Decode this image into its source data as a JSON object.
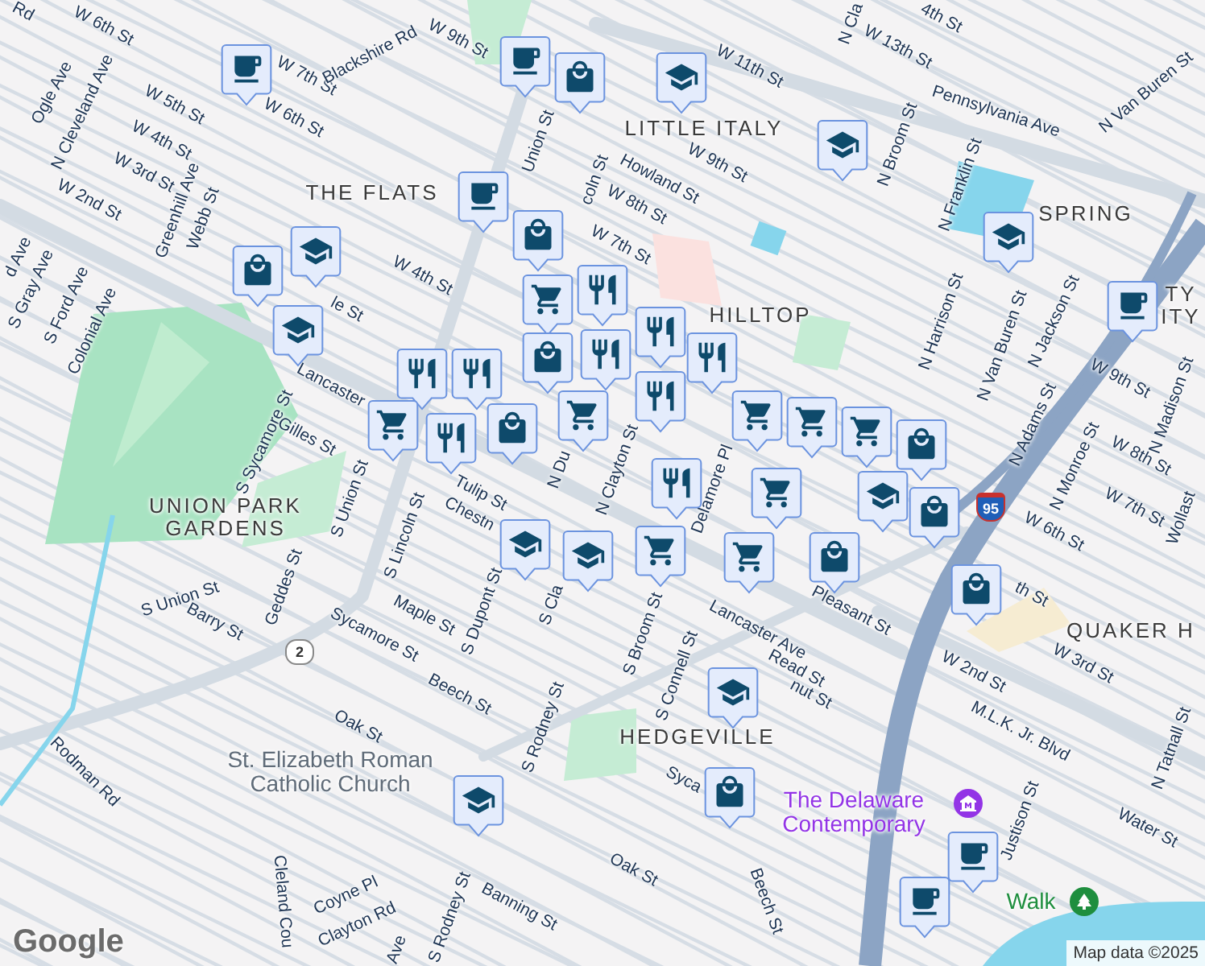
{
  "neighborhoods": [
    "THE FLATS",
    "LITTLE ITALY",
    "HILLTOP",
    "SPRING",
    "TY",
    "ITY",
    "UNION PARK GARDENS",
    "QUAKER H",
    "HEDGEVILLE"
  ],
  "streets": [
    "Rd",
    "W 6th St",
    "W 7th St",
    "Blackshire Rd",
    "W 6th St",
    "W 9th St",
    "W 5th St",
    "Ogle Ave",
    "N Cleveland Ave",
    "W 4th St",
    "W 3rd St",
    "W 2nd St",
    "Greenhill Ave",
    "Webb St",
    "d Ave",
    "S Gray Ave",
    "S Ford Ave",
    "Colonial Ave",
    "W 4th St",
    "le St",
    "Lancaster",
    "S Sycamore St",
    "Gilles St",
    "Union St",
    "coln St",
    "W 11th St",
    "N Cla",
    "W 13th St",
    "4th St",
    "Pennsylvania Ave",
    "N Broom St",
    "N Franklin St",
    "Howland St",
    "W 9th St",
    "W 8th St",
    "W 7th St",
    "N Van Buren St",
    "N Harrison St",
    "N Van Buren St",
    "N Jackson St",
    "W 9th St",
    "N Madison St",
    "N Adams St",
    "N Monroe St",
    "W 8th St",
    "W 7th St",
    "W 6th St",
    "Wollast",
    "N Clayton St",
    "Delamore Pl",
    "N Du",
    "Tulip St",
    "Chestn",
    "S Union St",
    "S Lincoln St",
    "Maple St",
    "S Dupont St",
    "S Cla",
    "Barry St",
    "Geddes St",
    "Sycamore St",
    "S Union St",
    "Beech St",
    "S Rodney St",
    "Oak St",
    "Rodman Rd",
    "Coyne Pl",
    "Clayton Rd",
    "Cleland Cou",
    "Banning St",
    "S Rodney St",
    "S Broom St",
    "S Connell St",
    "Pleasant St",
    "Lancaster Ave",
    "Read St",
    "nut St",
    "W 2nd St",
    "W 3rd St",
    "M.L.K. Jr. Blvd",
    "N Tatnall St",
    "Justison St",
    "Water St",
    "Syca",
    "Oak St",
    "Beech St",
    "th St",
    "Ave"
  ],
  "route_shields": [
    "2",
    "95"
  ],
  "places": [
    {
      "name": "St. Elizabeth Roman Catholic Church",
      "color": "#5f6b78"
    },
    {
      "name": "The Delaware Contemporary",
      "color": "#9334e6"
    },
    {
      "name": "Walk",
      "color": "#1e8e3e"
    }
  ],
  "markers": [
    {
      "kind": "coffee"
    },
    {
      "kind": "coffee"
    },
    {
      "kind": "shopping"
    },
    {
      "kind": "school"
    },
    {
      "kind": "school"
    },
    {
      "kind": "coffee"
    },
    {
      "kind": "shopping"
    },
    {
      "kind": "shopping"
    },
    {
      "kind": "school"
    },
    {
      "kind": "school"
    },
    {
      "kind": "school"
    },
    {
      "kind": "coffee"
    },
    {
      "kind": "grocery"
    },
    {
      "kind": "restaurant"
    },
    {
      "kind": "restaurant"
    },
    {
      "kind": "shopping"
    },
    {
      "kind": "restaurant"
    },
    {
      "kind": "restaurant"
    },
    {
      "kind": "restaurant"
    },
    {
      "kind": "restaurant"
    },
    {
      "kind": "restaurant"
    },
    {
      "kind": "grocery"
    },
    {
      "kind": "grocery"
    },
    {
      "kind": "restaurant"
    },
    {
      "kind": "shopping"
    },
    {
      "kind": "grocery"
    },
    {
      "kind": "grocery"
    },
    {
      "kind": "grocery"
    },
    {
      "kind": "shopping"
    },
    {
      "kind": "shopping"
    },
    {
      "kind": "school"
    },
    {
      "kind": "restaurant"
    },
    {
      "kind": "grocery"
    },
    {
      "kind": "grocery"
    },
    {
      "kind": "school"
    },
    {
      "kind": "school"
    },
    {
      "kind": "grocery"
    },
    {
      "kind": "shopping"
    },
    {
      "kind": "shopping"
    },
    {
      "kind": "school"
    },
    {
      "kind": "school"
    },
    {
      "kind": "shopping"
    },
    {
      "kind": "coffee"
    },
    {
      "kind": "coffee"
    }
  ],
  "logo": "Google",
  "attribution": "Map data ©2025"
}
